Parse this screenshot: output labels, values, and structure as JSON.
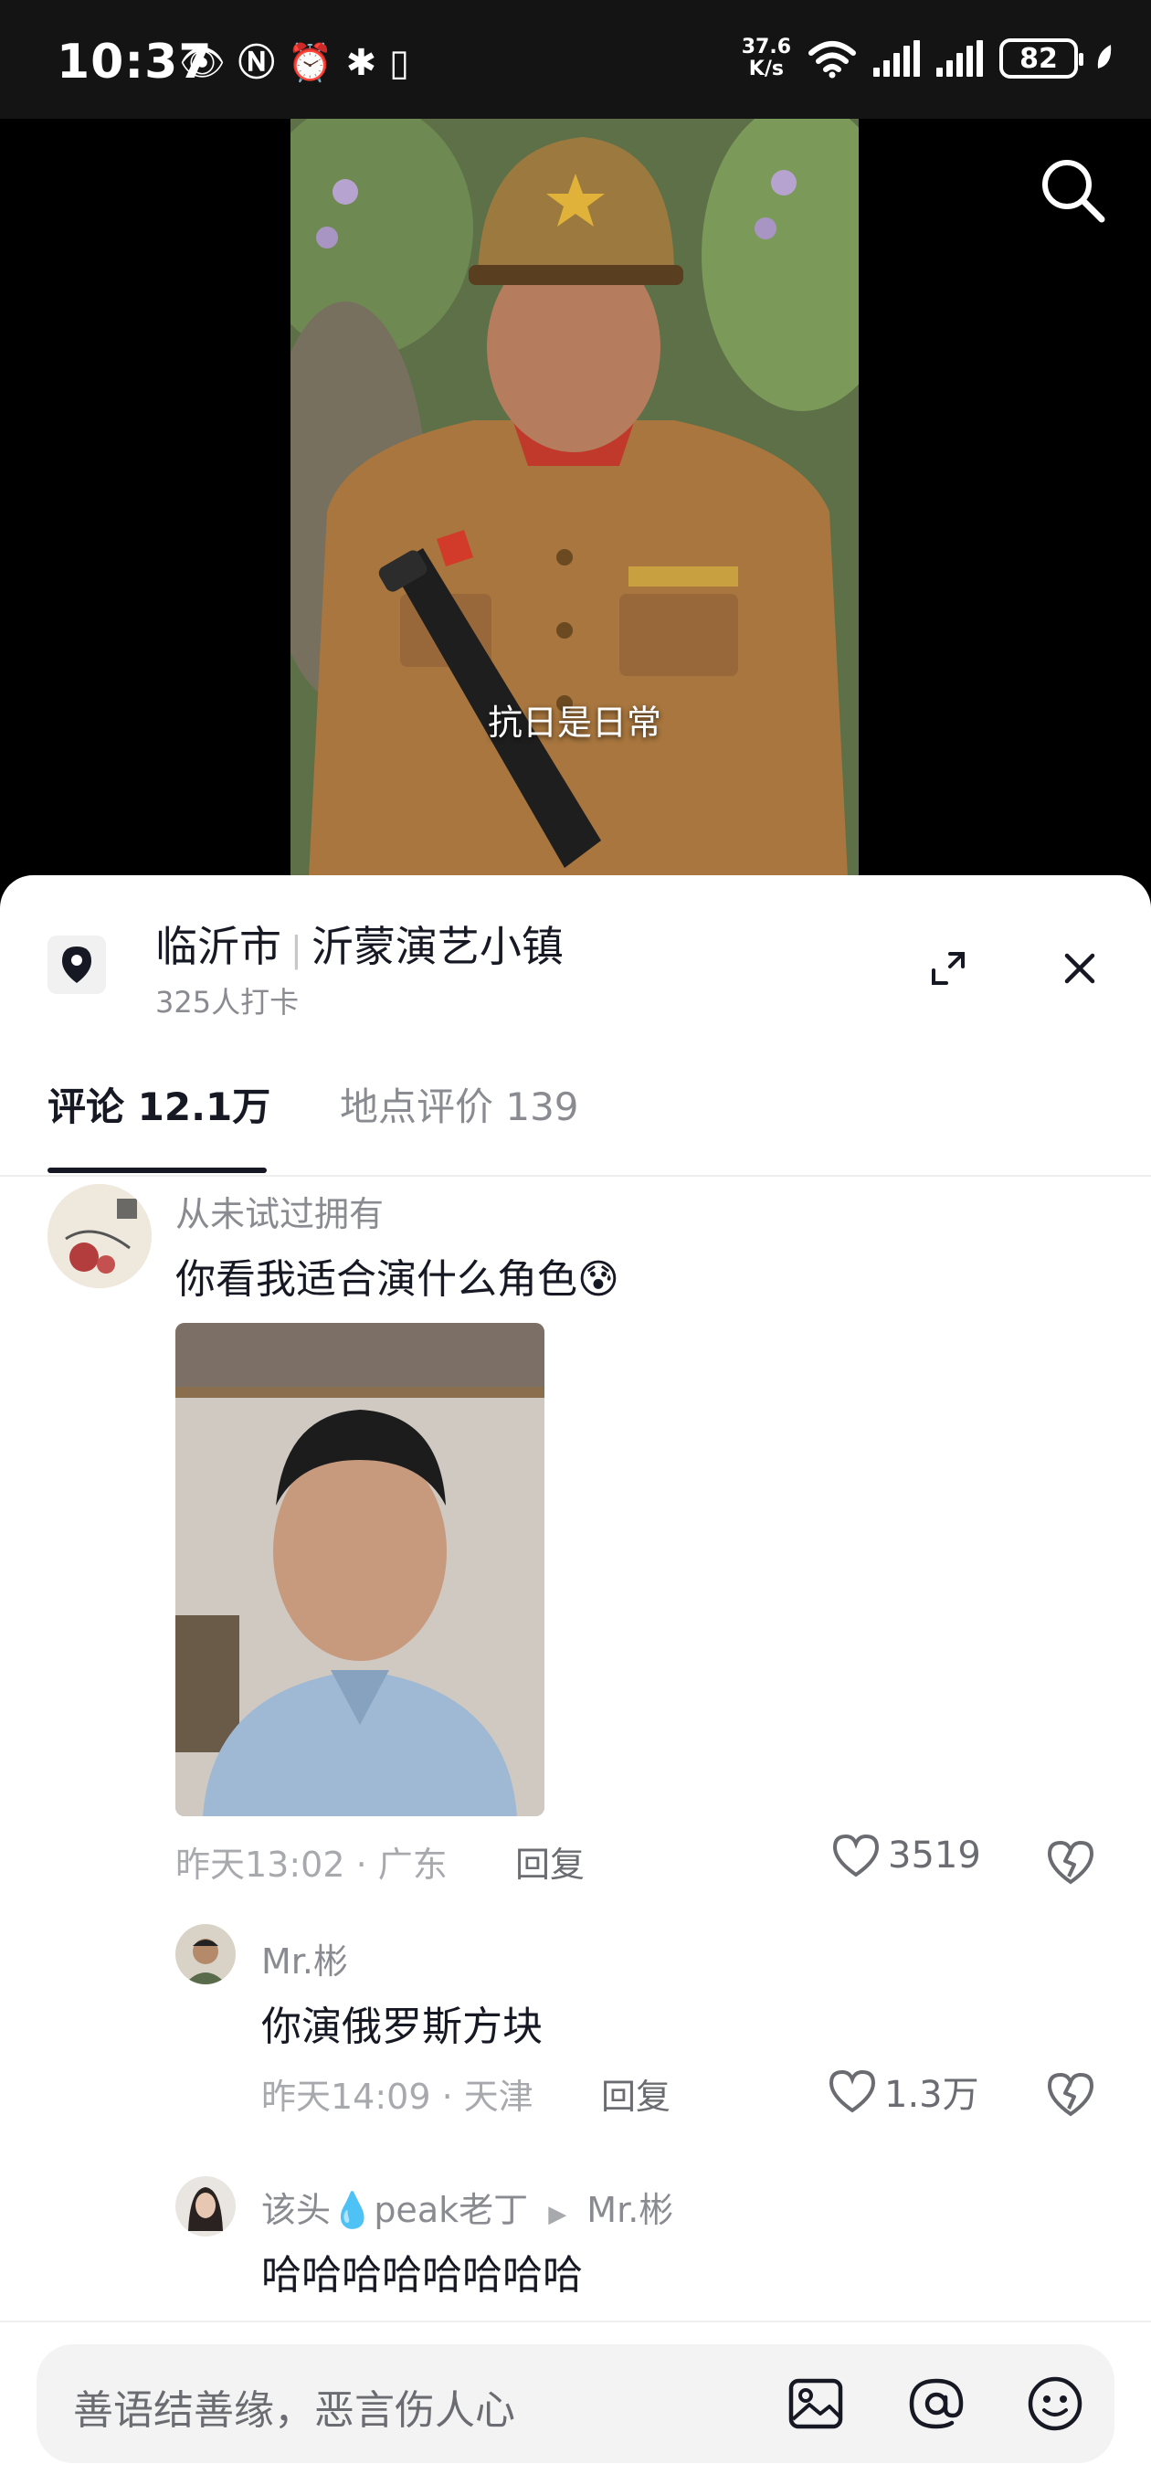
{
  "status_bar": {
    "time": "10:37",
    "net_speed_value": "37.6",
    "net_speed_unit": "K/s",
    "battery": "82"
  },
  "video": {
    "subtitle": "抗日是日常"
  },
  "location": {
    "city": "临沂市",
    "place": "沂蒙演艺小镇",
    "checkins": "325人打卡"
  },
  "tabs": [
    {
      "label": "评论 12.1万",
      "active": true
    },
    {
      "label": "地点评价 139",
      "active": false
    }
  ],
  "comments": [
    {
      "username": "从未试过拥有",
      "text": "你看我适合演什么角色",
      "emoji": "😰",
      "time_location": "昨天13:02 · 广东",
      "reply_label": "回复",
      "likes": "3519"
    },
    {
      "username": "Mr.彬",
      "text": "你演俄罗斯方块",
      "time_location": "昨天14:09 · 天津",
      "reply_label": "回复",
      "likes": "1.3万"
    },
    {
      "username": "该头💧peak老丁",
      "reply_to": "Mr.彬",
      "text": "哈哈哈哈哈哈哈哈"
    }
  ],
  "input": {
    "placeholder": "善语结善缘，恶言伤人心"
  }
}
